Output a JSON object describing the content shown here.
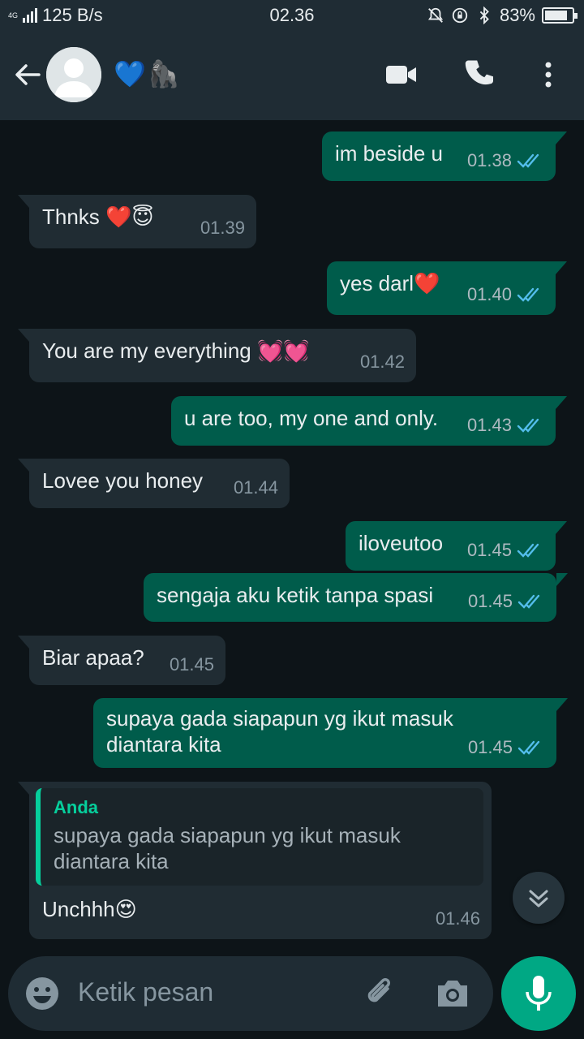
{
  "status_bar": {
    "network": "4G",
    "speed": "125 B/s",
    "time": "02.36",
    "battery": "83%",
    "battery_level": 0.83
  },
  "header": {
    "contact_name": "💙🦍",
    "icons": [
      "back-arrow-icon",
      "avatar-icon",
      "video-call-icon",
      "phone-icon",
      "more-vert-icon"
    ]
  },
  "messages": [
    {
      "direction": "out",
      "text": "im beside u",
      "time": "01.38",
      "read": true
    },
    {
      "direction": "in",
      "text": "Thnks ❤️😇",
      "time": "01.39"
    },
    {
      "direction": "out",
      "text": "yes darl❤️",
      "time": "01.40",
      "read": true
    },
    {
      "direction": "in",
      "text": "You are my everything 💓💓",
      "time": "01.42"
    },
    {
      "direction": "out",
      "text": "u are too, my one and only.",
      "time": "01.43",
      "read": true
    },
    {
      "direction": "in",
      "text": "Lovee you honey",
      "time": "01.44"
    },
    {
      "direction": "out",
      "text": "iloveutoo",
      "time": "01.45",
      "read": true
    },
    {
      "direction": "out",
      "text": "sengaja aku ketik tanpa spasi",
      "time": "01.45",
      "read": true
    },
    {
      "direction": "in",
      "text": "Biar apaa?",
      "time": "01.45"
    },
    {
      "direction": "out",
      "text_line1": "supaya gada siapapun yg ikut masuk",
      "text_line2": "diantara kita",
      "time": "01.45",
      "read": true
    },
    {
      "direction": "in",
      "quote_author": "Anda",
      "quote_line1": "supaya gada siapapun yg ikut masuk",
      "quote_line2": "diantara kita",
      "text": "Unchhh😍",
      "time": "01.46"
    }
  ],
  "input": {
    "placeholder": "Ketik pesan",
    "icons": [
      "emoji-icon",
      "attach-icon",
      "camera-icon",
      "mic-icon"
    ]
  },
  "colors": {
    "background": "#0d1418",
    "header": "#1f2c34",
    "outgoing": "#005c4b",
    "incoming": "#202c33",
    "accent": "#00a884",
    "read_ticks": "#53bdeb"
  }
}
